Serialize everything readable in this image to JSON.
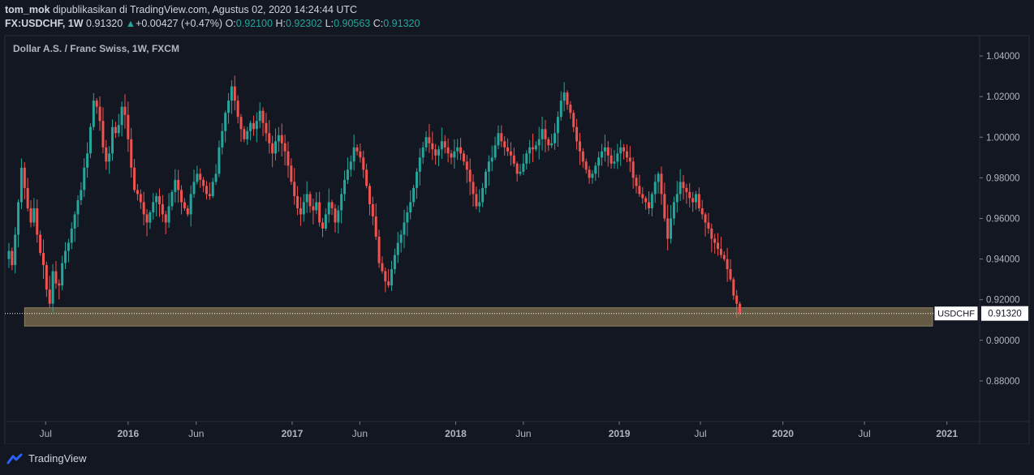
{
  "header": {
    "author": "tom_mok",
    "published_text": "dipublikasikan di TradingView.com, Agustus 02, 2020 14:24:44 UTC",
    "symbol": "FX:USDCHF, 1W",
    "last": "0.91320",
    "change_arrow": "▲",
    "change": "+0.00427 (+0.47%)",
    "o_label": "O:",
    "o_val": "0.92100",
    "h_label": "H:",
    "h_val": "0.92302",
    "l_label": "L:",
    "l_val": "0.90563",
    "c_label": "C:",
    "c_val": "0.91320"
  },
  "chart_title": "Dollar A.S. / Franc Swiss, 1W, FXCM",
  "price_label": {
    "symbol": "USDCHF",
    "value": "0.91320"
  },
  "footer": {
    "brand": "TradingView"
  },
  "colors": {
    "up": "#26a69a",
    "down": "#ef5350",
    "zone": "#7b6d4f",
    "bg": "#131722",
    "text": "#d1d4dc"
  },
  "chart_data": {
    "type": "candlestick",
    "ylim": [
      0.86,
      1.05
    ],
    "y_ticks": [
      "0.88000",
      "0.90000",
      "0.92000",
      "0.94000",
      "0.96000",
      "0.98000",
      "1.00000",
      "1.02000",
      "1.04000"
    ],
    "x_ticks": [
      {
        "label": "Jul",
        "date": "2015-07-01"
      },
      {
        "label": "2016",
        "date": "2016-01-01"
      },
      {
        "label": "Jun",
        "date": "2016-06-01"
      },
      {
        "label": "2017",
        "date": "2017-01-01"
      },
      {
        "label": "Jun",
        "date": "2017-06-01"
      },
      {
        "label": "2018",
        "date": "2018-01-01"
      },
      {
        "label": "Jun",
        "date": "2018-06-01"
      },
      {
        "label": "2019",
        "date": "2019-01-01"
      },
      {
        "label": "Jul",
        "date": "2019-07-01"
      },
      {
        "label": "2020",
        "date": "2020-01-01"
      },
      {
        "label": "Jul",
        "date": "2020-07-01"
      },
      {
        "label": "2021",
        "date": "2021-01-01"
      }
    ],
    "support_zone": {
      "from": 0.907,
      "to": 0.916,
      "start": "2015-05-15"
    },
    "last_price": 0.9132,
    "first_week": "2015-04-10",
    "weekly_close": [
      0.944,
      0.937,
      0.952,
      0.968,
      0.985,
      0.975,
      0.965,
      0.958,
      0.965,
      0.952,
      0.943,
      0.937,
      0.925,
      0.918,
      0.934,
      0.928,
      0.927,
      0.938,
      0.944,
      0.948,
      0.955,
      0.962,
      0.969,
      0.974,
      0.985,
      0.992,
      1.005,
      1.018,
      1.015,
      1.008,
      0.995,
      0.988,
      0.992,
      1.005,
      1.002,
      1.006,
      1.015,
      1.011,
      0.999,
      0.985,
      0.974,
      0.972,
      0.968,
      0.962,
      0.958,
      0.963,
      0.968,
      0.971,
      0.967,
      0.962,
      0.958,
      0.966,
      0.973,
      0.979,
      0.974,
      0.968,
      0.965,
      0.962,
      0.972,
      0.978,
      0.982,
      0.979,
      0.976,
      0.972,
      0.971,
      0.978,
      0.982,
      0.995,
      1.003,
      1.012,
      1.018,
      1.025,
      1.018,
      1.01,
      1.004,
      0.999,
      1.003,
      1.007,
      1.004,
      1.008,
      1.013,
      1.007,
      1.002,
      0.997,
      0.992,
      0.998,
      1.001,
      0.997,
      0.993,
      0.986,
      0.978,
      0.971,
      0.965,
      0.962,
      0.968,
      0.972,
      0.966,
      0.964,
      0.968,
      0.958,
      0.955,
      0.962,
      0.968,
      0.965,
      0.958,
      0.964,
      0.972,
      0.979,
      0.984,
      0.988,
      0.995,
      0.993,
      0.99,
      0.984,
      0.976,
      0.967,
      0.961,
      0.951,
      0.938,
      0.934,
      0.929,
      0.927,
      0.935,
      0.942,
      0.948,
      0.952,
      0.958,
      0.963,
      0.968,
      0.975,
      0.983,
      0.99,
      0.995,
      1,
      0.997,
      0.994,
      0.991,
      0.994,
      0.998,
      0.995,
      0.992,
      0.99,
      0.993,
      0.995,
      0.992,
      0.988,
      0.984,
      0.978,
      0.972,
      0.966,
      0.968,
      0.975,
      0.983,
      0.988,
      0.99,
      0.996,
      1.002,
      0.998,
      0.995,
      0.993,
      0.991,
      0.987,
      0.982,
      0.983,
      0.987,
      0.992,
      0.995,
      0.994,
      0.996,
      0.999,
      1.004,
      0.999,
      0.996,
      0.997,
      1.002,
      1.01,
      1.018,
      1.022,
      1.016,
      1.012,
      1.005,
      0.998,
      0.993,
      0.988,
      0.984,
      0.98,
      0.982,
      0.986,
      0.99,
      0.993,
      0.995,
      0.991,
      0.987,
      0.988,
      0.992,
      0.995,
      0.993,
      0.99,
      0.988,
      0.98,
      0.976,
      0.972,
      0.97,
      0.968,
      0.965,
      0.972,
      0.978,
      0.982,
      0.972,
      0.96,
      0.95,
      0.96,
      0.968,
      0.972,
      0.978,
      0.975,
      0.973,
      0.97,
      0.968,
      0.972,
      0.965,
      0.962,
      0.958,
      0.955,
      0.95,
      0.948,
      0.945,
      0.942,
      0.94,
      0.935,
      0.93,
      0.922,
      0.918,
      0.9132
    ]
  }
}
